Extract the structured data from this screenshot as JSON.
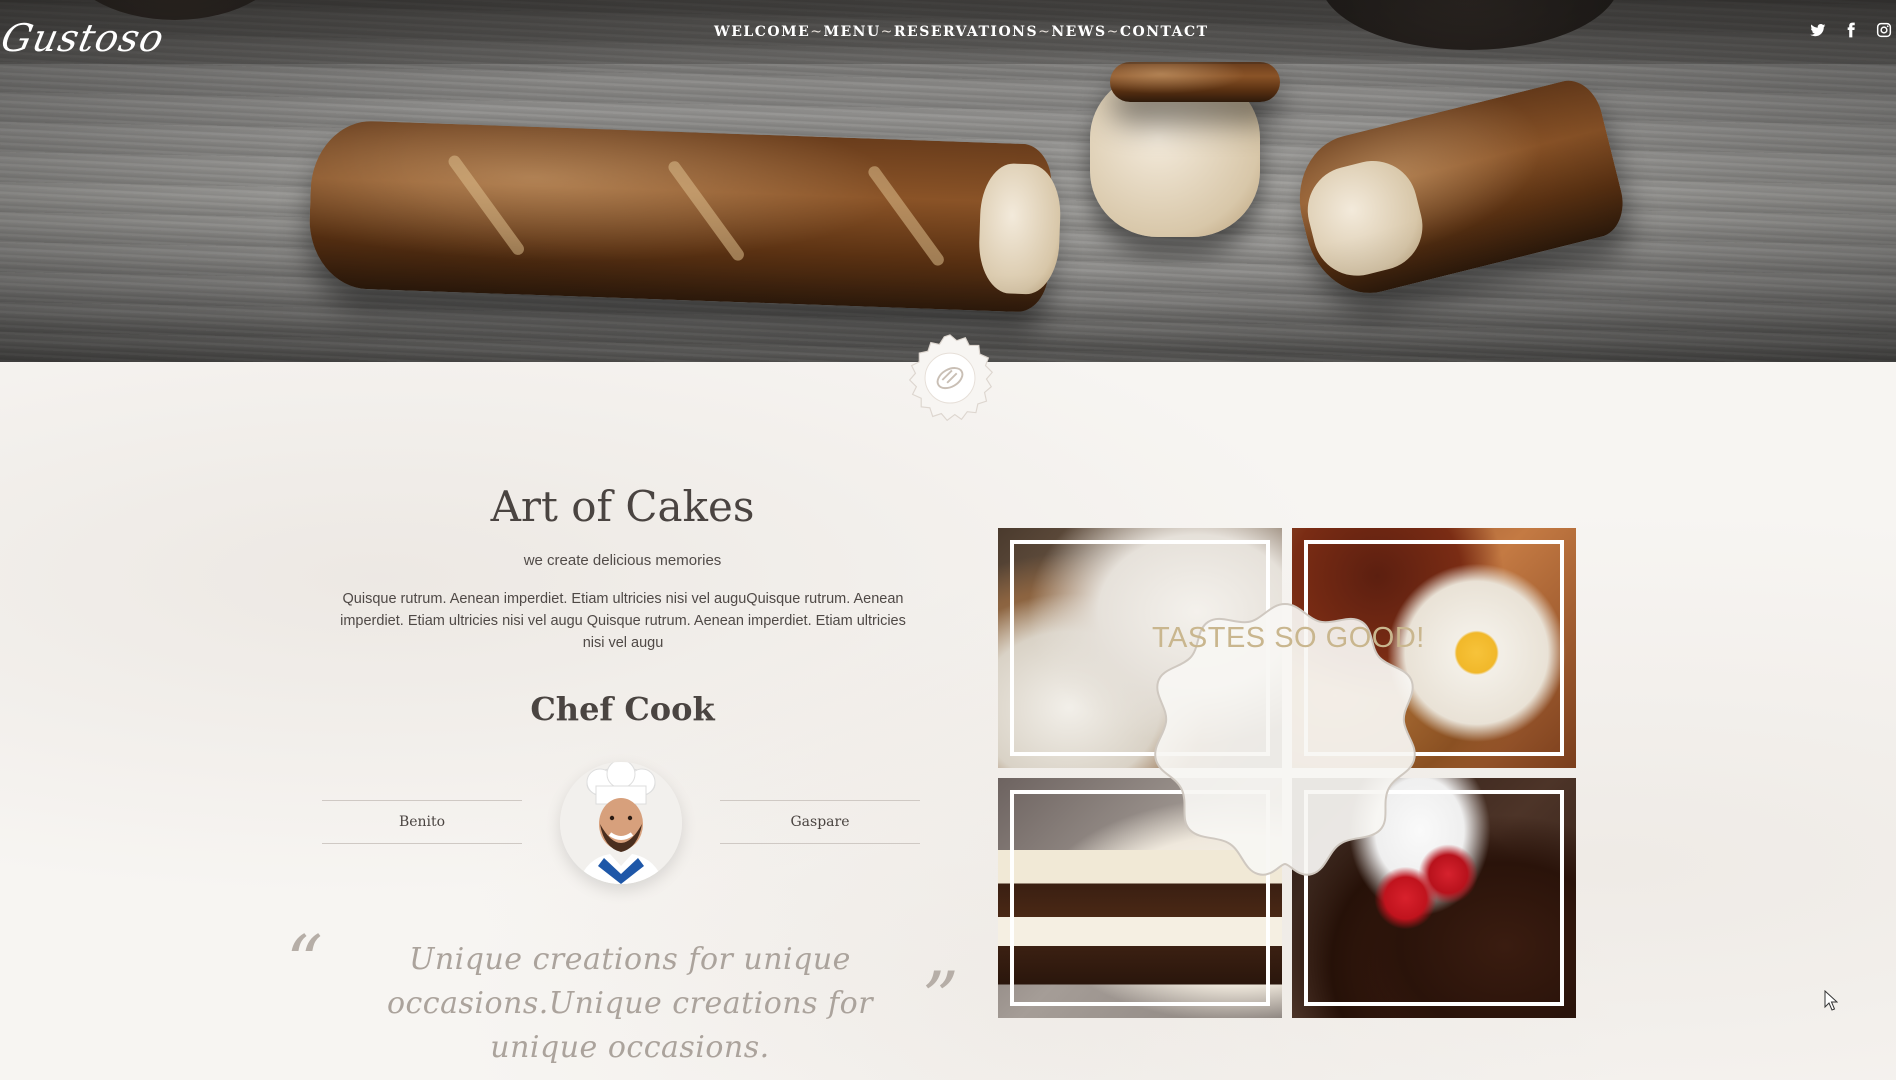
{
  "brand": {
    "logo_text": "Gustoso"
  },
  "nav": {
    "items": [
      "WELCOME",
      "MENU",
      "RESERVATIONS",
      "NEWS",
      "CONTACT"
    ],
    "separator": "~"
  },
  "social": {
    "icons": [
      "twitter-icon",
      "facebook-icon",
      "instagram-icon"
    ]
  },
  "about": {
    "title": "Art of Cakes",
    "subtitle": "we create delicious memories",
    "body": "Quisque rutrum. Aenean imperdiet. Etiam ultricies nisi vel auguQuisque rutrum. Aenean imperdiet. Etiam ultricies nisi vel augu Quisque rutrum. Aenean imperdiet. Etiam ultricies nisi vel augu"
  },
  "chefs": {
    "title": "Chef Cook",
    "left_name": "Benito",
    "right_name": "Gaspare"
  },
  "quote": {
    "open_mark": "“",
    "text": "Unique creations for unique occasions.Unique creations for unique occasions.",
    "close_mark": "”"
  },
  "gallery": {
    "overlay_text": "TASTES SO GOOD!",
    "tiles": [
      "flour-and-scoop",
      "bread-and-egg",
      "chocolate-cheesecake",
      "strawberry-chocolate-cakes"
    ]
  },
  "colors": {
    "text": "#4a4441",
    "quote": "#aba39c",
    "overlay_text": "#c9b68e",
    "background": "#f6f3f0"
  }
}
